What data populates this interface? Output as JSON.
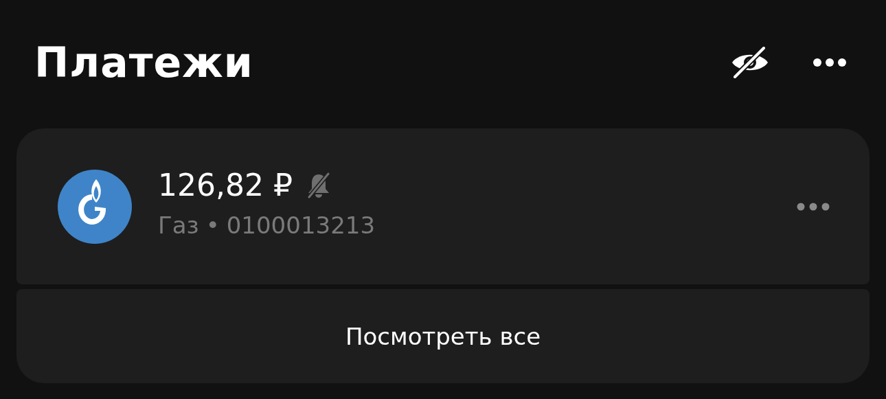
{
  "header": {
    "title": "Платежи"
  },
  "payments": [
    {
      "amount": "126,82 ₽",
      "muted": true,
      "category": "Газ",
      "separator": "•",
      "account": "0100013213"
    }
  ],
  "footer_button": {
    "label": "Посмотреть все"
  }
}
